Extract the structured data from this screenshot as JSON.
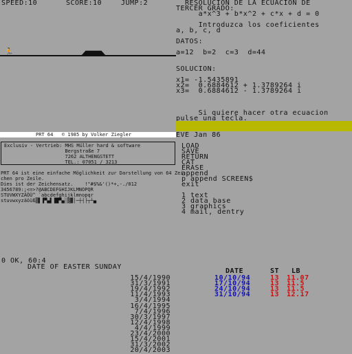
{
  "game": {
    "speed": "SPEED:10",
    "score": "SCORE:10",
    "jump": "JUMP:2",
    "runner_icon": "runner-icon"
  },
  "solver": {
    "lines": [
      "  RESOLUCION DE LA ECUACION DE",
      "TERCER GRADO:",
      "     a*x^3 + b*x^2 + c*x + d = 0",
      "",
      "     Introduzca los coeficientes",
      "a, b, c, d",
      "",
      "DATOS:",
      "",
      "a=12  b=2  c=3  d=44",
      "",
      "",
      "SOLUCION:",
      "",
      "x1= -1.5435891",
      "x2=  0.6884612 + 1.3789264 i",
      "x3=  0.6884612 - 1.3789264 i",
      "",
      "",
      "",
      "     Si quiere hacer otra ecuacion",
      "pulse una tecla."
    ]
  },
  "prt": {
    "title": "PRT 64   © 1985 by Volker Ziegler",
    "vendor_lines": [
      "Exclusiv - Vertrieb: MHS Müller hard & software",
      "                     Bergstraße 7",
      "                     7262 ALTHENGSTETT",
      "                     TEL.: 07051 / 3213"
    ],
    "body_lines": [
      "PRT 64 ist eine einfache Möglichkeit zur Darstellung von 64 Zei-",
      "chen pro Zeile.",
      "Dies ist der Zeichensatz.    !\"#$%&'()*+,-./012",
      "3456789:;<=>?@ABCDEFGHIJKLMNOPQR",
      "STUVWXYZÄÖÜ^_`abcdefghijklmnopqr",
      "stuvwxyzäöüß▒▌▐▀▄▌▐█▀▄░▒▓│─┼┤├┬┴▄"
    ]
  },
  "menu": {
    "header": "EVE Jan 86",
    "items": [
      "LOAD",
      "SAVE",
      "RETURN",
      "CAT",
      "ERASE",
      "append",
      "p append SCREEN$",
      "exit"
    ],
    "numbered": [
      "1 text",
      "2 data base",
      "3 graphics",
      "4 mail, dentry"
    ]
  },
  "easter": {
    "status": "0 OK, 60:4",
    "title": "DATE OF EASTER SUNDAY",
    "dates": [
      "15/4/1990",
      "31/3/1991",
      "19/4/1992",
      "11/4/1993",
      "3/4/1994",
      "16/4/1995",
      "7/4/1996",
      "30/3/1997",
      "12/4/1998",
      "4/4/1999",
      "23/4/2000",
      "15/4/2001",
      "31/3/2002",
      "20/4/2003"
    ]
  },
  "table": {
    "headers": {
      "date": "DATE",
      "st": "ST",
      "lb": "LB"
    },
    "rows": [
      {
        "date": "10/10/94",
        "st": "13",
        "lb": "11.07"
      },
      {
        "date": "17/10/94",
        "st": "13",
        "lb": "11.5"
      },
      {
        "date": "24/10/94",
        "st": "13",
        "lb": "11.5"
      },
      {
        "date": "31/10/94",
        "st": "13",
        "lb": "12.17"
      }
    ]
  },
  "colors": {
    "background": "#a3a3a3",
    "highlight_bar": "#b8b800",
    "date_blue": "#1010b8",
    "value_red": "#c81010"
  }
}
